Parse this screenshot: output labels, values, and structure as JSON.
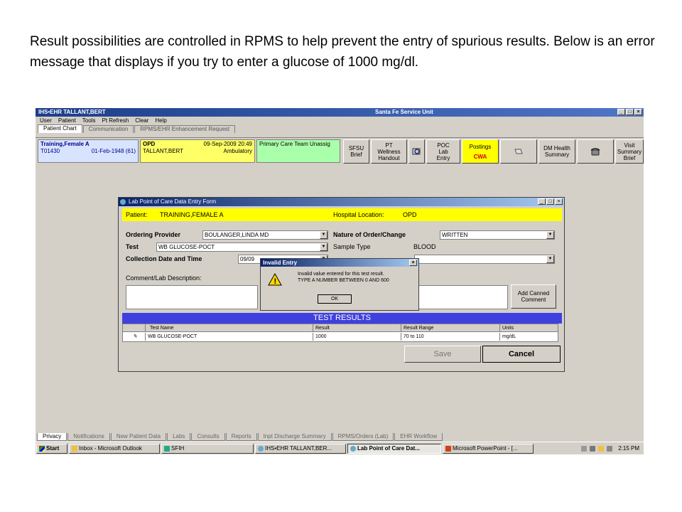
{
  "caption": "Result possibilities are controlled in RPMS to help prevent the entry of spurious results. Below is an error message that displays if you try to enter a glucose of 1000 mg/dl.",
  "app": {
    "title": "IHS•EHR  TALLANT,BERT",
    "center_title": "Santa Fe Service Unit",
    "window_buttons": [
      "_",
      "□",
      "×"
    ],
    "menu": [
      "User",
      "Patient",
      "Tools",
      "Pt Refresh",
      "Clear",
      "Help"
    ],
    "tabs": [
      "Patient Chart",
      "Communication",
      "RPMS/EHR Enhancement Request"
    ],
    "patient_box": {
      "name": "Training,Female A",
      "id": "T01430",
      "dob": "01-Feb-1948 (61)"
    },
    "visit_box": {
      "loc": "OPD",
      "date": "09-Sep-2009 20:49",
      "provider": "TALLANT,BERT",
      "type": "Ambulatory"
    },
    "team_box": "Primary Care Team Unassig",
    "buttons": {
      "sfsu": "SFSU\nBrief",
      "pt_wellness": "PT\nWellness\nHandout",
      "poc_lab": "POC\nLab\nEntry",
      "postings": "Postings",
      "cwa": "CWA",
      "dm_health": "DM Health\nSummary",
      "visit_summary": "Visit\nSummary\nBrief"
    },
    "bottom_tabs": [
      "Privacy",
      "Notifications",
      "New Patient Data",
      "Labs",
      "Consults",
      "Reports",
      "Inpt Discharge Summary",
      "RPMS/Orders (Lab)",
      "EHR Workflow"
    ]
  },
  "taskbar": {
    "start": "Start",
    "items": [
      "Inbox - Microsoft Outlook",
      "SFIH",
      "IHS•EHR  TALLANT,BER...",
      "Lab Point of Care Dat...",
      "Microsoft PowerPoint - [..."
    ],
    "time": "2:15 PM"
  },
  "dialog": {
    "title": "Lab Point of Care Data Entry Form",
    "patient_label": "Patient:",
    "patient_value": "TRAINING,FEMALE A",
    "hospital_label": "Hospital Location:",
    "hospital_value": "OPD",
    "ordering_provider_label": "Ordering Provider",
    "ordering_provider_value": "BOULANGER,LINDA MD",
    "test_label": "Test",
    "test_value": "WB GLUCOSE-POCT",
    "collection_label": "Collection Date and Time",
    "collection_value": "09/09",
    "comment_label": "Comment/Lab Description:",
    "nature_label": "Nature of Order/Change",
    "nature_value": "WRITTEN",
    "sample_type_label": "Sample Type",
    "sample_type_value": "BLOOD",
    "add_canned": "Add Canned\nComment",
    "test_results_header": "TEST RESULTS",
    "grid_headers": [
      "Test Name",
      "Result",
      "Result Range",
      "Units"
    ],
    "grid_row": [
      "WB GLUCOSE-POCT",
      "1000",
      "70 to 110",
      "mg/dL"
    ],
    "save": "Save",
    "cancel": "Cancel"
  },
  "modal": {
    "title": "Invalid Entry",
    "line1": "Invalid value entered for this test result.",
    "line2": "TYPE A NUMBER BETWEEN 0 AND 600",
    "ok": "OK"
  },
  "colors": {
    "titlebar": "#1c3e8a",
    "yellow": "#ffff00",
    "green_box": "#aaffaa",
    "results_header": "#4040e0"
  }
}
